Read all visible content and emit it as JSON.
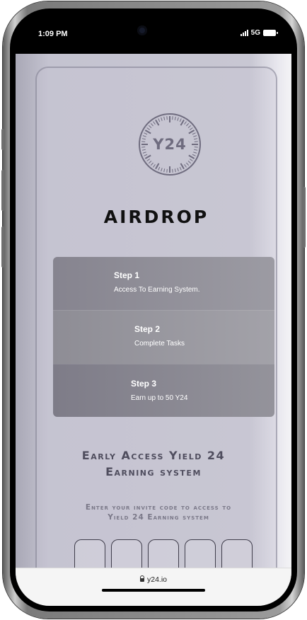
{
  "status_bar": {
    "time": "1:09 PM",
    "network": "5G"
  },
  "logo": {
    "text": "Y24",
    "ring_color": "#6f6c7f"
  },
  "page_title": "AIRDROP",
  "steps": [
    {
      "title": "Step 1",
      "description": "Access To Earning System."
    },
    {
      "title": "Step 2",
      "description": "Complete Tasks"
    },
    {
      "title": "Step 3",
      "description": "Earn up to 50 Y24"
    }
  ],
  "headline": {
    "line1": "Early Access Yield 24",
    "line2": "Earning system"
  },
  "invite_prompt": "Enter your invite code to access to Yield 24 Earning system",
  "invite_code": {
    "slots": [
      "",
      "",
      "",
      "",
      ""
    ]
  },
  "browser": {
    "url": "y24.io"
  },
  "icons": {
    "status_signal": "signal-icon",
    "status_battery": "battery-icon",
    "url_lock": "lock-icon",
    "camera": "camera-icon"
  },
  "colors": {
    "page_background": "#c6c5d1",
    "step_card": "#8e8d95",
    "headline_text": "#4f4d5e"
  }
}
